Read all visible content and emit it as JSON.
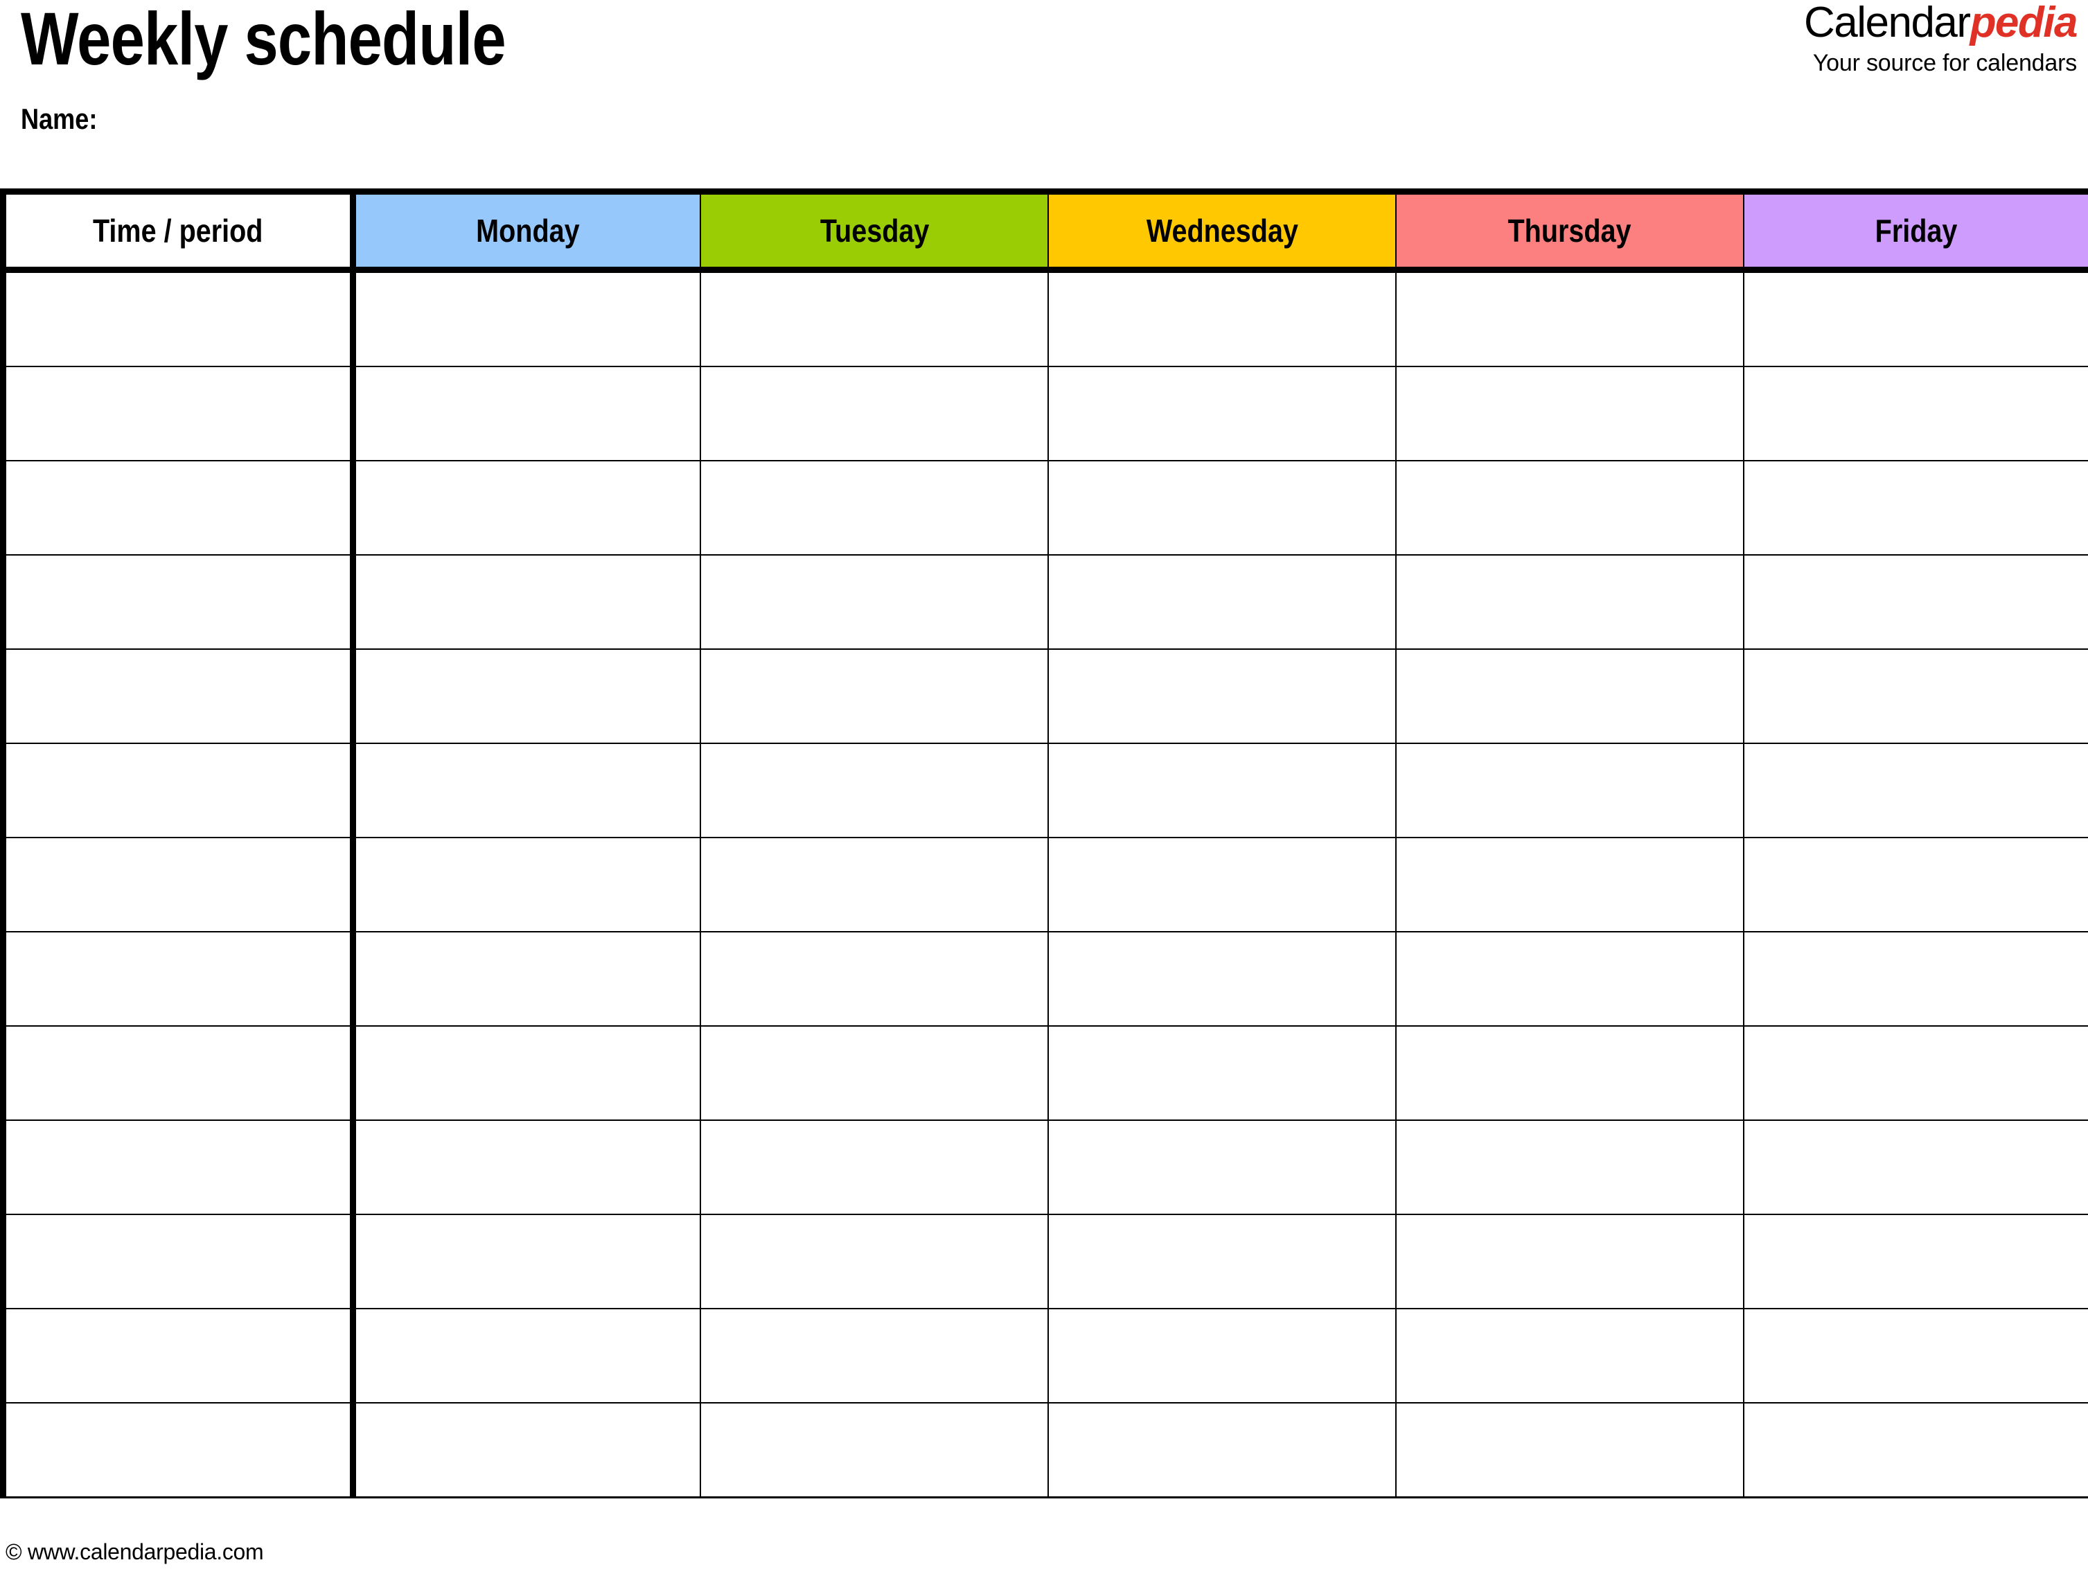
{
  "document": {
    "title": "Weekly schedule",
    "name_label": "Name:"
  },
  "brand": {
    "name_part1": "Calendar",
    "name_part2": "pedia",
    "tagline": "Your source for calendars",
    "accent_color": "#e03127"
  },
  "table": {
    "columns": [
      {
        "label": "Time / period",
        "bg": "#ffffff"
      },
      {
        "label": "Monday",
        "bg": "#96c8fc"
      },
      {
        "label": "Tuesday",
        "bg": "#9bcd04"
      },
      {
        "label": "Wednesday",
        "bg": "#ffc800"
      },
      {
        "label": "Thursday",
        "bg": "#fc8080"
      },
      {
        "label": "Friday",
        "bg": "#cd9cfc"
      }
    ],
    "row_count": 13,
    "rows": [
      {
        "cells": [
          "",
          "",
          "",
          "",
          "",
          ""
        ]
      },
      {
        "cells": [
          "",
          "",
          "",
          "",
          "",
          ""
        ]
      },
      {
        "cells": [
          "",
          "",
          "",
          "",
          "",
          ""
        ]
      },
      {
        "cells": [
          "",
          "",
          "",
          "",
          "",
          ""
        ]
      },
      {
        "cells": [
          "",
          "",
          "",
          "",
          "",
          ""
        ]
      },
      {
        "cells": [
          "",
          "",
          "",
          "",
          "",
          ""
        ]
      },
      {
        "cells": [
          "",
          "",
          "",
          "",
          "",
          ""
        ]
      },
      {
        "cells": [
          "",
          "",
          "",
          "",
          "",
          ""
        ]
      },
      {
        "cells": [
          "",
          "",
          "",
          "",
          "",
          ""
        ]
      },
      {
        "cells": [
          "",
          "",
          "",
          "",
          "",
          ""
        ]
      },
      {
        "cells": [
          "",
          "",
          "",
          "",
          "",
          ""
        ]
      },
      {
        "cells": [
          "",
          "",
          "",
          "",
          "",
          ""
        ]
      },
      {
        "cells": [
          "",
          "",
          "",
          "",
          "",
          ""
        ]
      }
    ]
  },
  "footer": {
    "copyright": "© www.calendarpedia.com"
  }
}
